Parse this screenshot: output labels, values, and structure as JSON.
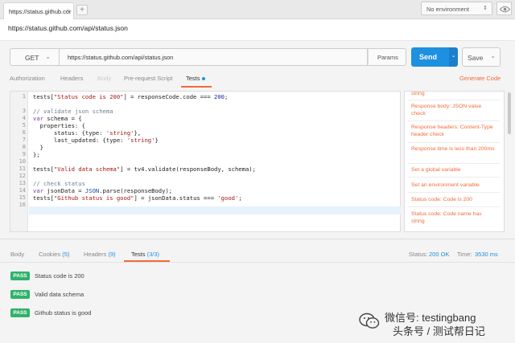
{
  "tab": {
    "label": "https://status.github.cor",
    "close": "×",
    "add": "+"
  },
  "environment": {
    "selected": "No environment"
  },
  "url_heading": "https://status.github.com/api/status.json",
  "request": {
    "method": "GET",
    "url": "https://status.github.com/api/status.json",
    "params_label": "Params",
    "send_label": "Send",
    "save_label": "Save"
  },
  "request_tabs": [
    {
      "label": "Authorization",
      "state": "normal"
    },
    {
      "label": "Headers",
      "state": "normal"
    },
    {
      "label": "Body",
      "state": "disabled"
    },
    {
      "label": "Pre-request Script",
      "state": "normal"
    },
    {
      "label": "Tests",
      "state": "active"
    }
  ],
  "generate_code": "Generate Code",
  "editor": {
    "line_numbers": [
      "1",
      "2",
      "3",
      "4",
      "5",
      "6",
      "7",
      "8",
      "9",
      "10",
      "11",
      "12",
      "13",
      "14",
      "15",
      "16"
    ]
  },
  "snippets": [
    "string",
    "Response body: JSON value check",
    "Response headers: Content-Type header check",
    "Response time is less than 200ms",
    "Set a global variable",
    "Set an environment variable",
    "Status code: Code is 200",
    "Status code: Code name has string"
  ],
  "response_tabs": [
    {
      "label": "Body",
      "count": ""
    },
    {
      "label": "Cookies",
      "count": "(5)"
    },
    {
      "label": "Headers",
      "count": "(9)"
    },
    {
      "label": "Tests",
      "count": "(3/3)"
    }
  ],
  "status": {
    "label": "Status:",
    "value": "200 OK"
  },
  "time": {
    "label": "Time:",
    "value": "3530 ms"
  },
  "test_results": [
    {
      "badge": "PASS",
      "text": "Status code is 200"
    },
    {
      "badge": "PASS",
      "text": "Valid data schema"
    },
    {
      "badge": "PASS",
      "text": "Github status is good"
    }
  ],
  "watermark": {
    "line1": "微信号: testingbang",
    "line2": "头条号 / 测试帮日记"
  },
  "colors": {
    "accent": "#f26b3a",
    "send": "#1e90e0",
    "pass": "#2fb26b"
  }
}
